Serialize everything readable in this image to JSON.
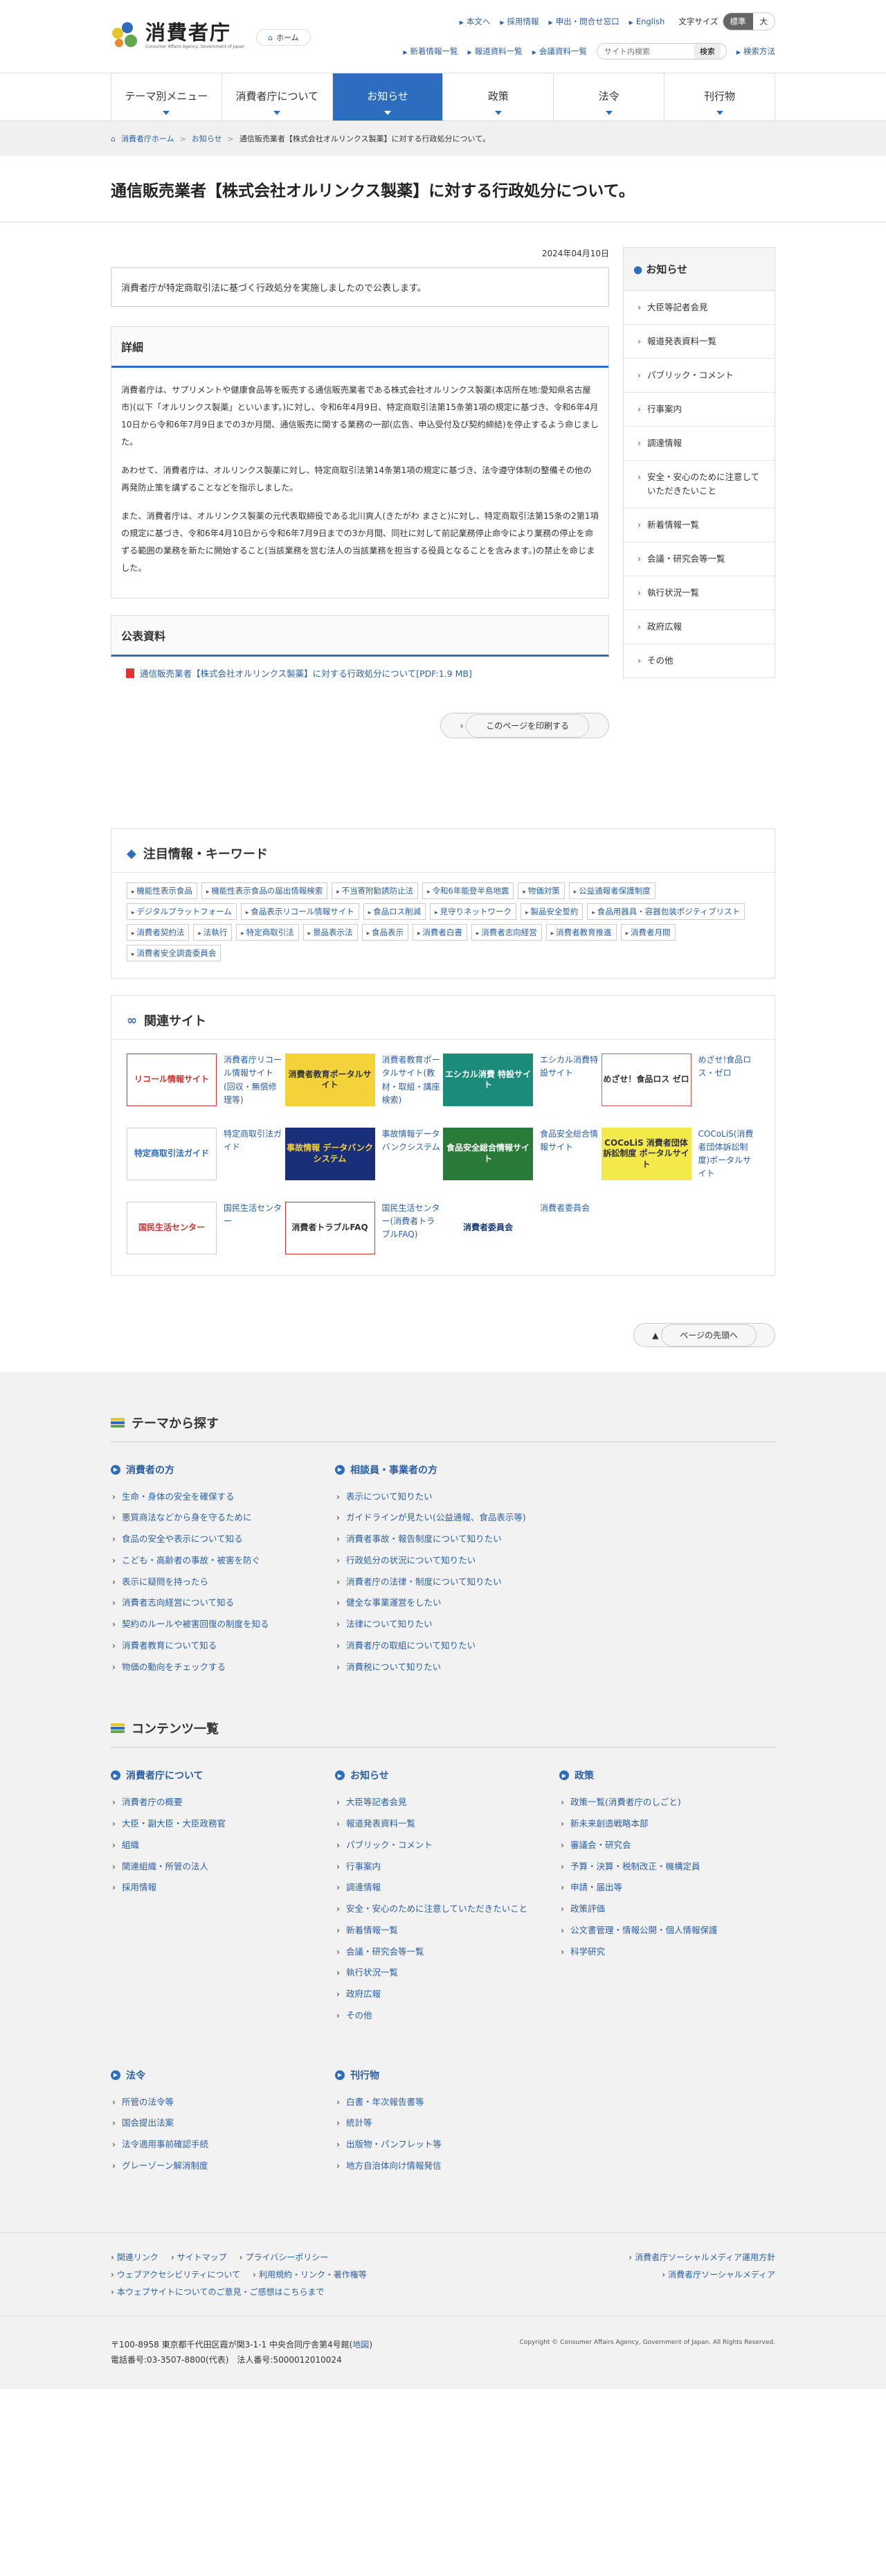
{
  "header": {
    "logo_text": "消費者庁",
    "logo_sub": "Consumer Affairs Agency, Government of Japan",
    "home": "ホーム",
    "utility": [
      "本文へ",
      "採用情報",
      "申出・問合せ窓口",
      "English"
    ],
    "font_size_label": "文字サイズ",
    "font_size_options": [
      "標準",
      "大"
    ],
    "utility2": [
      "新着情報一覧",
      "報道資料一覧",
      "会議資料一覧"
    ],
    "search_placeholder": "サイト内検索",
    "search_button": "検索",
    "search_help": "検索方法"
  },
  "nav": [
    {
      "label": "テーマ別メニュー",
      "active": false
    },
    {
      "label": "消費者庁について",
      "active": false
    },
    {
      "label": "お知らせ",
      "active": true
    },
    {
      "label": "政策",
      "active": false
    },
    {
      "label": "法令",
      "active": false
    },
    {
      "label": "刊行物",
      "active": false
    }
  ],
  "breadcrumb": [
    "消費者庁ホーム",
    "お知らせ",
    "通信販売業者【株式会社オルリンクス製薬】に対する行政処分について。"
  ],
  "page_title": "通信販売業者【株式会社オルリンクス製薬】に対する行政処分について。",
  "date": "2024年04月10日",
  "lead": "消費者庁が特定商取引法に基づく行政処分を実施しましたので公表します。",
  "detail": {
    "heading": "詳細",
    "paragraphs": [
      "消費者庁は、サプリメントや健康食品等を販売する通信販売業者である株式会社オルリンクス製薬(本店所在地:愛知県名古屋市)(以下「オルリンクス製薬」といいます。)に対し、令和6年4月9日、特定商取引法第15条第1項の規定に基づき、令和6年4月10日から令和6年7月9日までの3か月間、通信販売に関する業務の一部(広告、申込受付及び契約締結)を停止するよう命じました。",
      "あわせて、消費者庁は、オルリンクス製薬に対し、特定商取引法第14条第1項の規定に基づき、法令遵守体制の整備その他の再発防止策を講ずることなどを指示しました。",
      "また、消費者庁は、オルリンクス製薬の元代表取締役である北川爽人(きたがわ まさと)に対し、特定商取引法第15条の2第1項の規定に基づき、令和6年4月10日から令和6年7月9日までの3か月間、同社に対して前記業務停止命令により業務の停止を命ずる範囲の業務を新たに開始すること(当該業務を営む法人の当該業務を担当する役員となることを含みます。)の禁止を命じました。"
    ]
  },
  "public_docs": {
    "heading": "公表資料",
    "items": [
      "通信販売業者【株式会社オルリンクス製薬】に対する行政処分について[PDF:1.9 MB]"
    ]
  },
  "print_button": "このページを印刷する",
  "sidebar": {
    "heading": "お知らせ",
    "items": [
      "大臣等記者会見",
      "報道発表資料一覧",
      "パブリック・コメント",
      "行事案内",
      "調達情報",
      "安全・安心のために注意していただきたいこと",
      "新着情報一覧",
      "会議・研究会等一覧",
      "執行状況一覧",
      "政府広報",
      "その他"
    ]
  },
  "keywords": {
    "heading": "注目情報・キーワード",
    "items": [
      "機能性表示食品",
      "機能性表示食品の届出情報検索",
      "不当寄附勧誘防止法",
      "令和6年能登半島地震",
      "物価対策",
      "公益通報者保護制度",
      "デジタルプラットフォーム",
      "食品表示リコール情報サイト",
      "食品ロス削減",
      "見守りネットワーク",
      "製品安全誓約",
      "食品用器具・容器包装ポジティブリスト",
      "消費者契約法",
      "法執行",
      "特定商取引法",
      "景品表示法",
      "食品表示",
      "消費者白書",
      "消費者志向経営",
      "消費者教育推進",
      "消費者月間",
      "消費者安全調査委員会"
    ]
  },
  "related": {
    "heading": "関連サイト",
    "items": [
      {
        "banner": "リコール情報サイト",
        "label": "消費者庁リコール情報サイト(回収・無償修理等)"
      },
      {
        "banner": "消費者教育ポータルサイト",
        "label": "消費者教育ポータルサイト(教材・取組・講座検索)"
      },
      {
        "banner": "エシカル消費 特設サイト",
        "label": "エシカル消費特設サイト"
      },
      {
        "banner": "めざせ！食品ロス ゼロ",
        "label": "めざせ!食品ロス・ゼロ"
      },
      {
        "banner": "特定商取引法ガイド",
        "label": "特定商取引法ガイド"
      },
      {
        "banner": "事故情報 データバンクシステム",
        "label": "事故情報データバンクシステム"
      },
      {
        "banner": "食品安全総合情報サイト",
        "label": "食品安全総合情報サイト"
      },
      {
        "banner": "COCoLiS 消費者団体訴訟制度 ポータルサイト",
        "label": "COCoLiS(消費者団体訴訟制度)ポータルサイト"
      },
      {
        "banner": "国民生活センター",
        "label": "国民生活センター"
      },
      {
        "banner": "消費者トラブルFAQ",
        "label": "国民生活センター(消費者トラブルFAQ)"
      },
      {
        "banner": "消費者委員会",
        "label": "消費者委員会"
      }
    ]
  },
  "page_top": "ページの先頭へ",
  "theme": {
    "heading": "テーマから探す",
    "cols": [
      {
        "title": "消費者の方",
        "items": [
          "生命・身体の安全を確保する",
          "悪質商法などから身を守るために",
          "食品の安全や表示について知る",
          "こども・高齢者の事故・被害を防ぐ",
          "表示に疑問を持ったら",
          "消費者志向経営について知る",
          "契約のルールや被害回復の制度を知る",
          "消費者教育について知る",
          "物価の動向をチェックする"
        ]
      },
      {
        "title": "相談員・事業者の方",
        "items": [
          "表示について知りたい",
          "ガイドラインが見たい(公益通報、食品表示等)",
          "消費者事故・報告制度について知りたい",
          "行政処分の状況について知りたい",
          "消費者庁の法律・制度について知りたい",
          "健全な事業運営をしたい",
          "法律について知りたい",
          "消費者庁の取組について知りたい",
          "消費税について知りたい"
        ]
      }
    ]
  },
  "contents": {
    "heading": "コンテンツ一覧",
    "cols": [
      {
        "title": "消費者庁について",
        "items": [
          "消費者庁の概要",
          "大臣・副大臣・大臣政務官",
          "組織",
          "関連組織・所管の法人",
          "採用情報"
        ]
      },
      {
        "title": "お知らせ",
        "items": [
          "大臣等記者会見",
          "報道発表資料一覧",
          "パブリック・コメント",
          "行事案内",
          "調達情報",
          "安全・安心のために注意していただきたいこと",
          "新着情報一覧",
          "会議・研究会等一覧",
          "執行状況一覧",
          "政府広報",
          "その他"
        ]
      },
      {
        "title": "政策",
        "items": [
          "政策一覧(消費者庁のしごと)",
          "新未来創造戦略本部",
          "審議会・研究会",
          "予算・決算・税制改正・機構定員",
          "申請・届出等",
          "政策評価",
          "公文書管理・情報公開・個人情報保護",
          "科学研究"
        ]
      }
    ],
    "cols2": [
      {
        "title": "法令",
        "items": [
          "所管の法令等",
          "国会提出法案",
          "法令適用事前確認手続",
          "グレーゾーン解消制度"
        ]
      },
      {
        "title": "刊行物",
        "items": [
          "白書・年次報告書等",
          "統計等",
          "出版物・パンフレット等",
          "地方自治体向け情報発信"
        ]
      }
    ]
  },
  "footer": {
    "links": [
      "関連リンク",
      "サイトマップ",
      "プライバシーポリシー",
      "ウェブアクセシビリティについて",
      "利用規約・リンク・著作権等",
      "本ウェブサイトについてのご意見・ご感想はこちらまで"
    ],
    "links_right": [
      "消費者庁ソーシャルメディア運用方針",
      "消費者庁ソーシャルメディア"
    ],
    "address": "〒100-8958 東京都千代田区霞が関3-1-1 中央合同庁舎第4号館(",
    "map": "地図",
    "address_end": ")",
    "tel": "電話番号:03-3507-8800(代表)　法人番号:5000012010024",
    "copyright": "Copyright © Consumer Affairs Agency, Government of Japan. All Rights Reserved."
  }
}
